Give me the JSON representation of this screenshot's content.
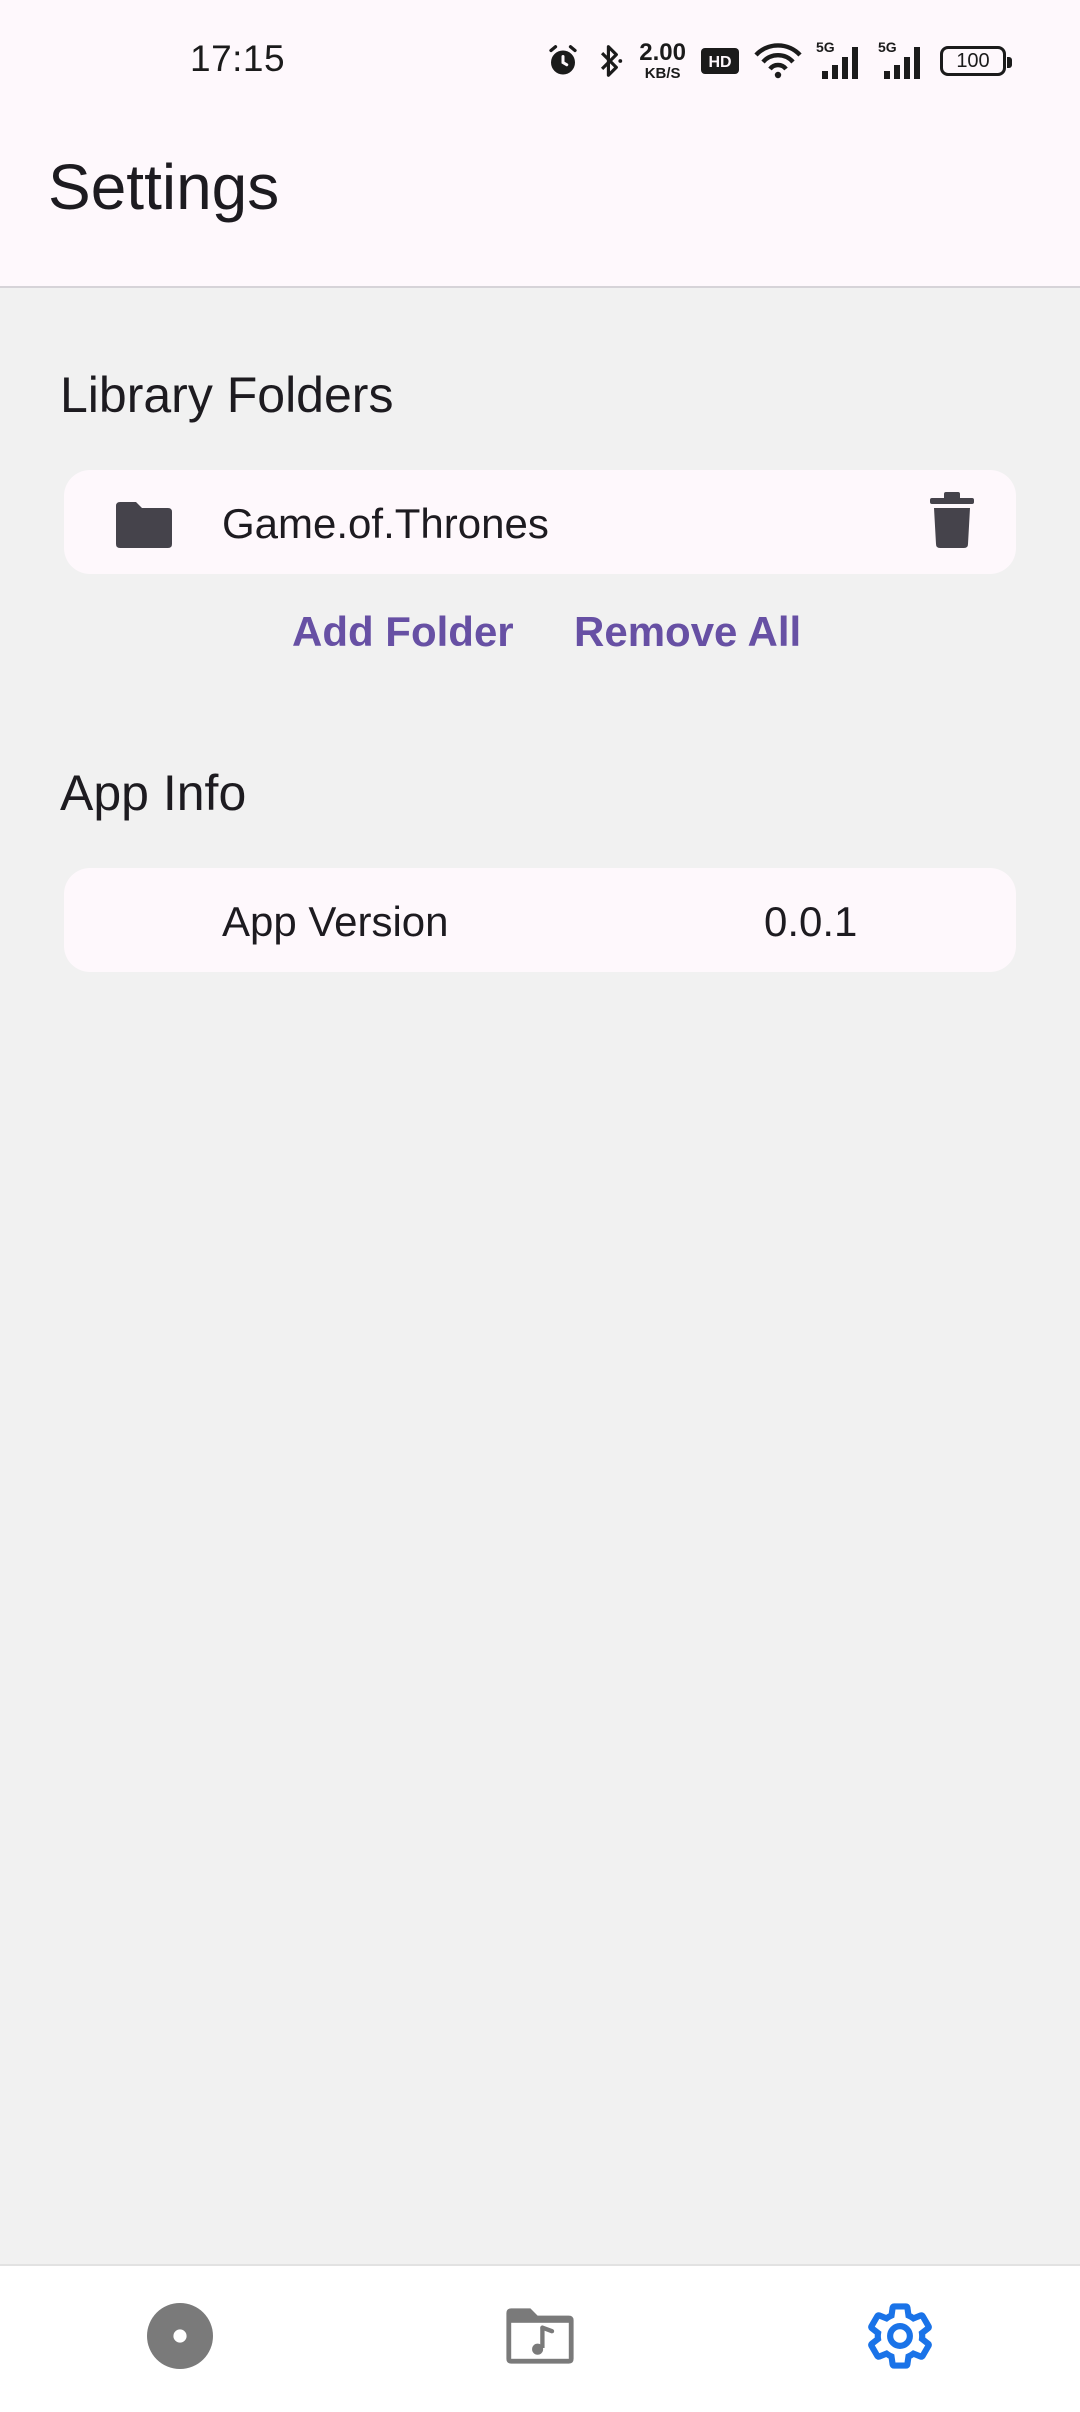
{
  "status_bar": {
    "time": "17:15",
    "net_speed_value": "2.00",
    "net_speed_unit": "KB/S",
    "hd_badge": "HD",
    "signal_1": "5G",
    "signal_2": "5G",
    "battery": "100",
    "icons": [
      "alarm-icon",
      "bluetooth-icon",
      "hd-icon",
      "wifi-icon",
      "signal-icon",
      "signal-icon",
      "battery-icon"
    ]
  },
  "app_bar": {
    "title": "Settings"
  },
  "library": {
    "title": "Library Folders",
    "folders": [
      {
        "name": "Game.of.Thrones",
        "icon": "folder-icon",
        "action_icon": "trash-icon"
      }
    ],
    "add_label": "Add Folder",
    "remove_all_label": "Remove All"
  },
  "app_info": {
    "title": "App Info",
    "version_label": "App Version",
    "version_value": "0.0.1"
  },
  "bottom_nav": {
    "items": [
      {
        "icon": "disc-icon",
        "active": false
      },
      {
        "icon": "music-folder-icon",
        "active": false
      },
      {
        "icon": "gear-icon",
        "active": true
      }
    ]
  },
  "colors": {
    "accent": "#6750a4",
    "nav_active": "#1a73e8",
    "nav_inactive": "#7a7a7a",
    "surface": "#fef8fc",
    "background": "#f1f1f1"
  }
}
